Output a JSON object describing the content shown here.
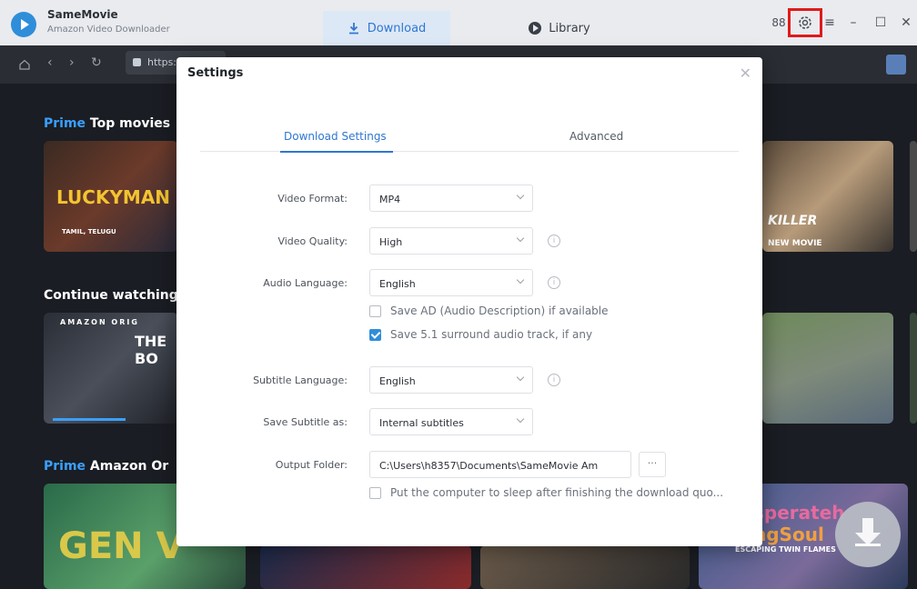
{
  "app": {
    "name": "SameMovie",
    "subtitle": "Amazon Video Downloader"
  },
  "tabs": {
    "download": "Download",
    "library": "Library"
  },
  "window_controls": {
    "apps": "88",
    "menu": "≡",
    "minimize": "–",
    "maximize": "☐",
    "close": "✕"
  },
  "browser": {
    "url": "https:"
  },
  "background": {
    "row1_prefix": "Prime",
    "row1_title": "Top movies",
    "row2_title": "Continue watching",
    "row3_prefix": "Prime",
    "row3_title": "Amazon Or",
    "poster1_title": "LUCKYMAN",
    "poster1_sub": "TAMIL, TELUGU",
    "poster2_tag": "NEW MOVIE",
    "poster2_title": "KILLER",
    "poster3_top": "AMAZON ORIG",
    "poster3_title": "THE BO",
    "poster4_title": "GEN V",
    "poster5_line1": "sperateh",
    "poster5_line2": "ngSoul",
    "poster5_sub": "ESCAPING TWIN FLAMES"
  },
  "dialog": {
    "title": "Settings",
    "close": "✕",
    "tab_download_settings": "Download Settings",
    "tab_advanced": "Advanced",
    "video_format_label": "Video Format:",
    "video_format_value": "MP4",
    "video_quality_label": "Video Quality:",
    "video_quality_value": "High",
    "audio_language_label": "Audio Language:",
    "audio_language_value": "English",
    "save_ad_label": "Save AD (Audio Description) if available",
    "save_51_label": "Save 5.1 surround audio track, if any",
    "subtitle_language_label": "Subtitle Language:",
    "subtitle_language_value": "English",
    "save_subtitle_label": "Save Subtitle as:",
    "save_subtitle_value": "Internal subtitles",
    "output_folder_label": "Output Folder:",
    "output_folder_value": "C:\\Users\\h8357\\Documents\\SameMovie Am",
    "more_button": "···",
    "sleep_label": "Put the computer to sleep after finishing the download quo..."
  },
  "colors": {
    "accent": "#2f77d1",
    "highlight_box": "#e11a1a",
    "prime": "#3aa0ff"
  }
}
